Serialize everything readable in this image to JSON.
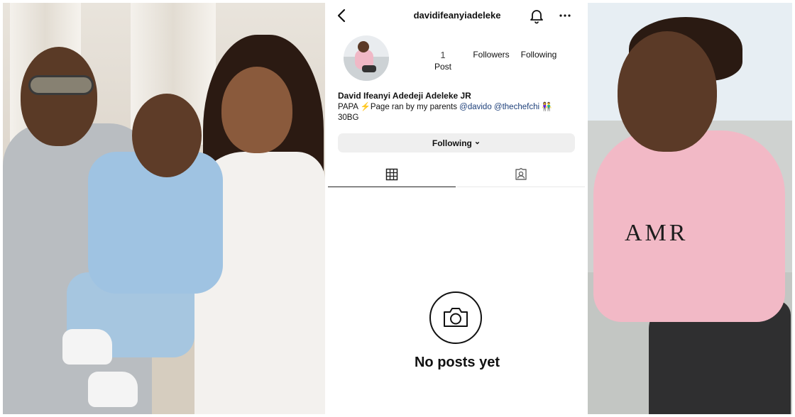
{
  "profile": {
    "username": "davidifeanyiadeleke",
    "display_name": "David Ifeanyi Adedeji Adeleke JR",
    "bio_prefix": "PAPA ⚡Page ran by my parents ",
    "bio_mention_1": "@davido",
    "bio_mention_2": "@thechefchi",
    "bio_emoji": "👫",
    "bio_line2": "30BG"
  },
  "stats": {
    "posts_count": "1",
    "posts_label": "Post",
    "followers_label": "Followers",
    "following_label": "Following"
  },
  "actions": {
    "following_button": "Following",
    "chevron": "⌄"
  },
  "empty_state": {
    "message": "No posts yet"
  },
  "photos": {
    "right_sweater_text": "AMR"
  },
  "colors": {
    "mention": "#1d3f7a",
    "button_bg": "#efefef"
  },
  "icons": {
    "back": "back-arrow-icon",
    "notifications": "bell-icon",
    "more": "more-horizontal-icon",
    "grid": "grid-icon",
    "tagged": "tagged-icon",
    "camera": "camera-icon"
  }
}
